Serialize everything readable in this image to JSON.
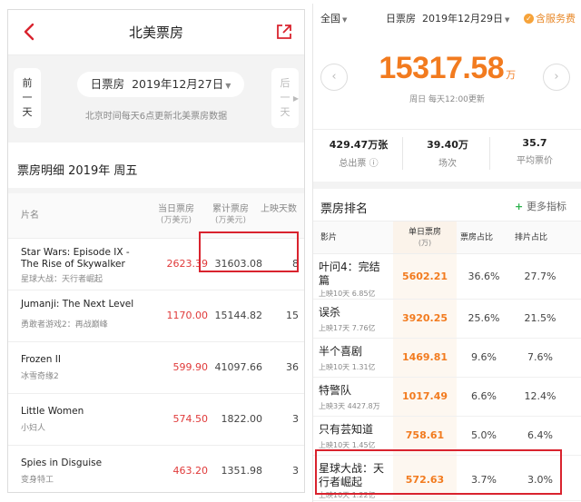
{
  "left": {
    "title": "北美票房",
    "prev_label": "前一天",
    "next_label": "后一天",
    "date_label": "日票房  2019年12月27日",
    "update_note": "北京时间每天6点更新北美票房数据",
    "section_title": "票房明细 2019年 周五",
    "columns": {
      "name": "片名",
      "daily": "当日票房",
      "daily_unit": "(万美元)",
      "total": "累计票房",
      "total_unit": "(万美元)",
      "days": "上映天数"
    },
    "rows": [
      {
        "en": "Star Wars: Episode IX - The Rise of Skywalker",
        "cn": "星球大战：天行者崛起",
        "daily": "2623.39",
        "total": "31603.08",
        "days": "8"
      },
      {
        "en": "Jumanji: The Next Level",
        "cn": "勇敢者游戏2：再战巅峰",
        "daily": "1170.00",
        "total": "15144.82",
        "days": "15"
      },
      {
        "en": "Frozen II",
        "cn": "冰雪奇缘2",
        "daily": "599.90",
        "total": "41097.66",
        "days": "36"
      },
      {
        "en": "Little Women",
        "cn": "小妇人",
        "daily": "574.50",
        "total": "1822.00",
        "days": "3"
      },
      {
        "en": "Spies in Disguise",
        "cn": "变身特工",
        "daily": "463.20",
        "total": "1351.98",
        "days": "3"
      }
    ]
  },
  "right": {
    "region": "全国",
    "date_label": "日票房  2019年12月29日",
    "fee_label": "含服务费",
    "total_value": "15317.58",
    "total_unit": "万",
    "update_note": "周日 每天12:00更新",
    "stats": [
      {
        "value": "429.47万张",
        "label": "总出票 ⓘ"
      },
      {
        "value": "39.40万",
        "label": "场次"
      },
      {
        "value": "35.7",
        "label": "平均票价"
      }
    ],
    "rank_title": "票房排名",
    "more_label": "更多指标",
    "columns": {
      "film": "影片",
      "gross": "单日票房",
      "gross_unit": "(万)",
      "share": "票房占比",
      "sched": "排片占比"
    },
    "rows": [
      {
        "name": "叶问4：完结篇",
        "meta": "上映10天 6.85亿",
        "gross": "5602.21",
        "share": "36.6%",
        "sched": "27.7%"
      },
      {
        "name": "误杀",
        "meta": "上映17天 7.76亿",
        "gross": "3920.25",
        "share": "25.6%",
        "sched": "21.5%"
      },
      {
        "name": "半个喜剧",
        "meta": "上映10天 1.31亿",
        "gross": "1469.81",
        "share": "9.6%",
        "sched": "7.6%"
      },
      {
        "name": "特警队",
        "meta": "上映3天 4427.8万",
        "gross": "1017.49",
        "share": "6.6%",
        "sched": "12.4%"
      },
      {
        "name": "只有芸知道",
        "meta": "上映10天 1.45亿",
        "gross": "758.61",
        "share": "5.0%",
        "sched": "6.4%"
      },
      {
        "name": "星球大战：天行者崛起",
        "meta": "上映10天 1.22亿",
        "gross": "572.63",
        "share": "3.7%",
        "sched": "3.0%"
      }
    ]
  }
}
